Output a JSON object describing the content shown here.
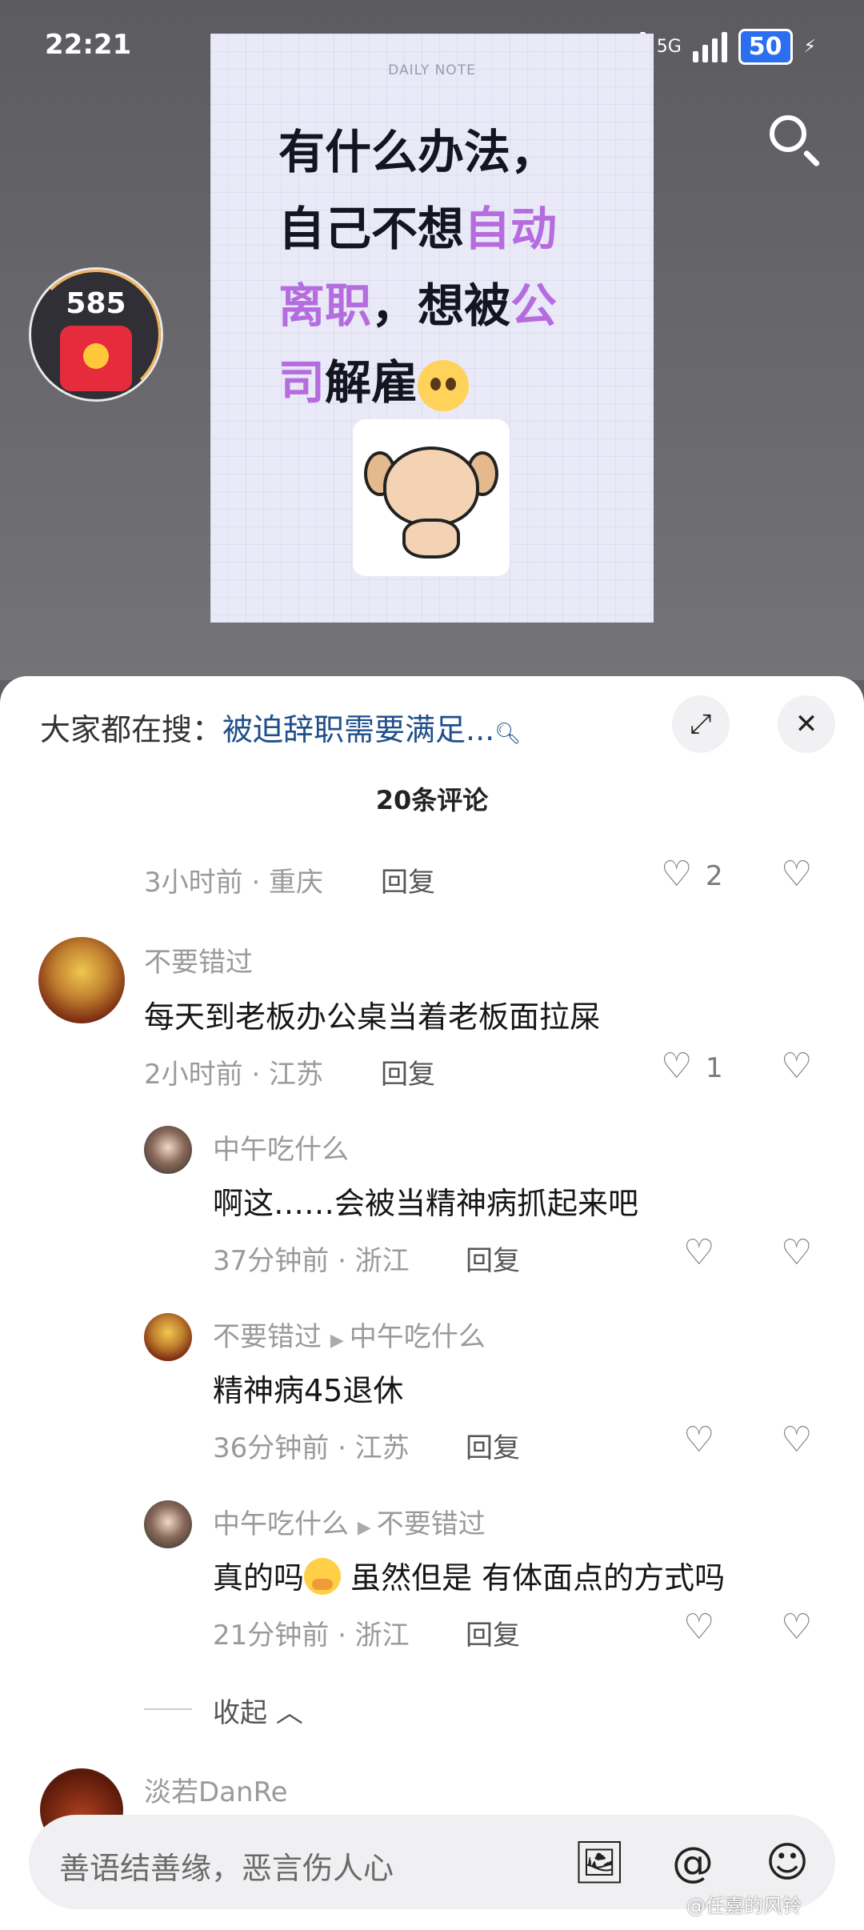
{
  "status": {
    "time": "22:21",
    "network1": "5G",
    "network2": "5G",
    "battery": "50"
  },
  "poster": {
    "note": "DAILY NOTE",
    "line1": "有什么办法，",
    "line2a": "自己不想",
    "line2b": "自动",
    "line3a": "离职",
    "line3b": "，想被",
    "line3c": "公",
    "line4a": "司",
    "line4b": "解雇"
  },
  "redpacket": {
    "count": "585"
  },
  "sheet": {
    "hot_label": "大家都在搜：",
    "hot_term": "被迫辞职需要满足...",
    "comment_count": "20条评论",
    "collapse_label": "收起",
    "reply_label": "回复",
    "input_placeholder": "善语结善缘，恶言伤人心",
    "partial_name": "淡若DanRe"
  },
  "comments": [
    {
      "meta": "3小时前 · 重庆",
      "likes": "2"
    },
    {
      "name": "不要错过",
      "text": "每天到老板办公桌当着老板面拉屎",
      "meta": "2小时前 · 江苏",
      "likes": "1"
    },
    {
      "name": "中午吃什么",
      "text": "啊这……会被当精神病抓起来吧",
      "meta": "37分钟前 · 浙江"
    },
    {
      "name": "不要错过",
      "to": "中午吃什么",
      "text": "精神病45退休",
      "meta": "36分钟前 · 江苏"
    },
    {
      "name": "中午吃什么",
      "to": "不要错过",
      "text_a": "真的吗",
      "text_b": " 虽然但是 有体面点的方式吗",
      "meta": "21分钟前 · 浙江"
    }
  ],
  "watermark": "@任嘉的风铃"
}
